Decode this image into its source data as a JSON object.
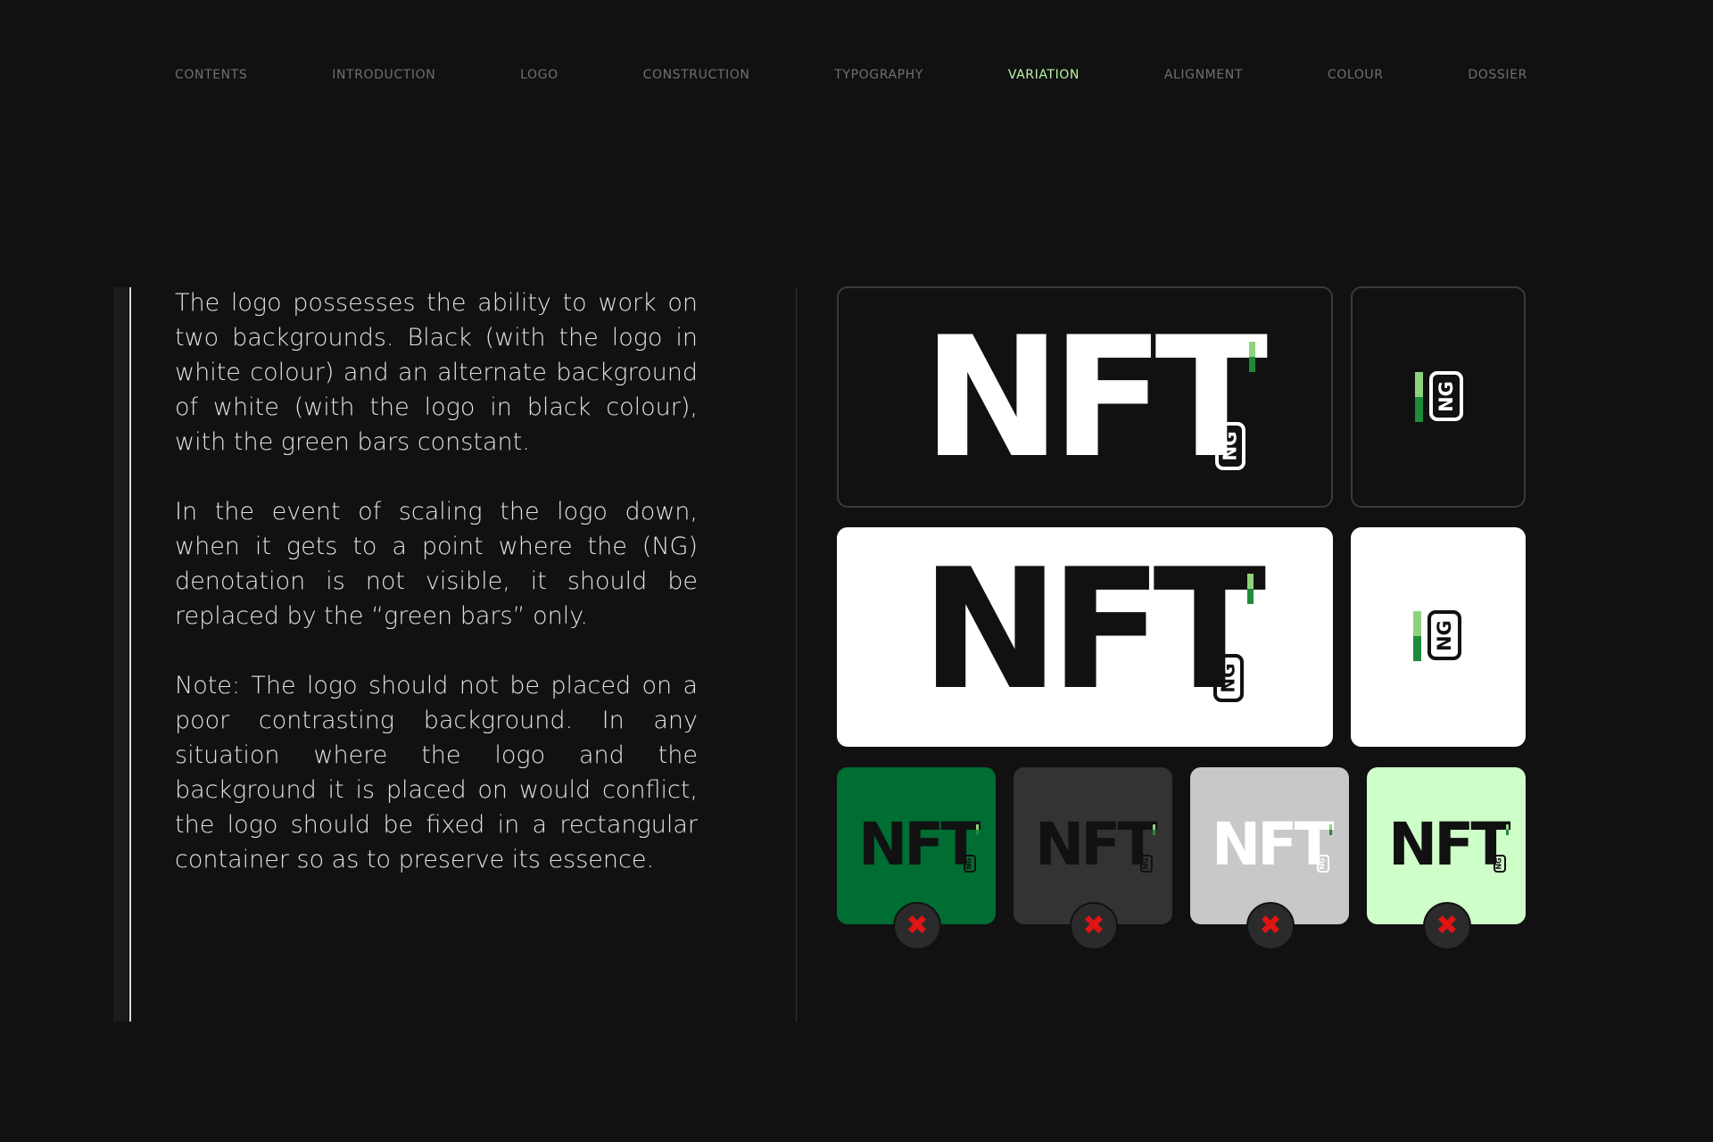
{
  "nav": {
    "items": [
      "CONTENTS",
      "INTRODUCTION",
      "LOGO",
      "CONSTRUCTION",
      "TYPOGRAPHY",
      "VARIATION",
      "ALIGNMENT",
      "COLOUR",
      "DOSSIER"
    ],
    "active": "VARIATION"
  },
  "content": {
    "paragraphs": [
      "The logo possesses the ability to work on two backgrounds. Black (with the logo in white colour) and an alternate background of white (with the logo in black colour), with the green bars constant.",
      "In the event of scaling the logo down, when it gets to a point where the (NG) denotation is not visible, it should be replaced by the “green bars” only.",
      "Note: The logo should not be placed on a poor contrasting background. In any situation where the logo and the background it is placed on would conflict, the logo should be fixed in a rectangular container so as to preserve its essence."
    ]
  },
  "logo": {
    "wordmark": "NFT",
    "badge": "NG"
  },
  "colors": {
    "accent_nav": "#b9f5a6",
    "green_light": "#8fd27d",
    "green_dark": "#1f8a3b",
    "bad_bg_green": "#006d33",
    "bad_bg_grey": "#333333",
    "bad_bg_silver": "#c8c8c8",
    "bad_bg_mint": "#cfffc8",
    "x_red": "#e01414"
  },
  "icons": {
    "wrong": "x-icon"
  }
}
